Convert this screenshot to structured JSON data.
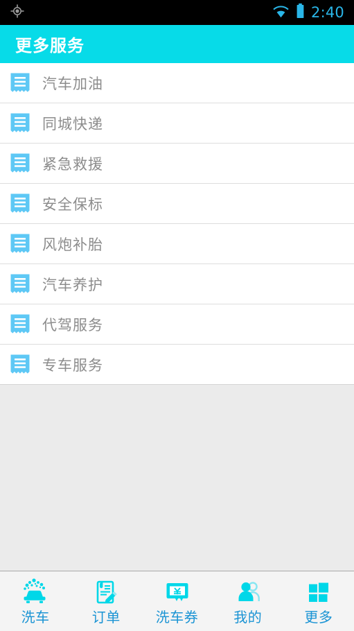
{
  "status_bar": {
    "gps_icon": "gps-location-icon",
    "wifi_icon": "wifi-icon",
    "battery_icon": "battery-icon",
    "time": "2:40",
    "time_color": "#2ab6e8",
    "background": "#000000"
  },
  "header": {
    "title": "更多服务",
    "background": "#07dbe8",
    "text_color": "#ffffff"
  },
  "list": {
    "icon_name": "receipt-icon",
    "icon_color": "#5ec8f5",
    "items": [
      {
        "label": "汽车加油"
      },
      {
        "label": "同城快递"
      },
      {
        "label": "紧急救援"
      },
      {
        "label": "安全保标"
      },
      {
        "label": "风炮补胎"
      },
      {
        "label": "汽车养护"
      },
      {
        "label": "代驾服务"
      },
      {
        "label": "专车服务"
      }
    ]
  },
  "tabbar": {
    "background": "#f4f4f4",
    "icon_color": "#00d7e8",
    "label_color": "#1b94d4",
    "tabs": [
      {
        "label": "洗车",
        "icon": "car-wash-icon"
      },
      {
        "label": "订单",
        "icon": "order-document-pencil-icon"
      },
      {
        "label": "洗车券",
        "icon": "coupon-yen-icon"
      },
      {
        "label": "我的",
        "icon": "users-profile-icon"
      },
      {
        "label": "更多",
        "icon": "grid-more-icon"
      }
    ]
  }
}
